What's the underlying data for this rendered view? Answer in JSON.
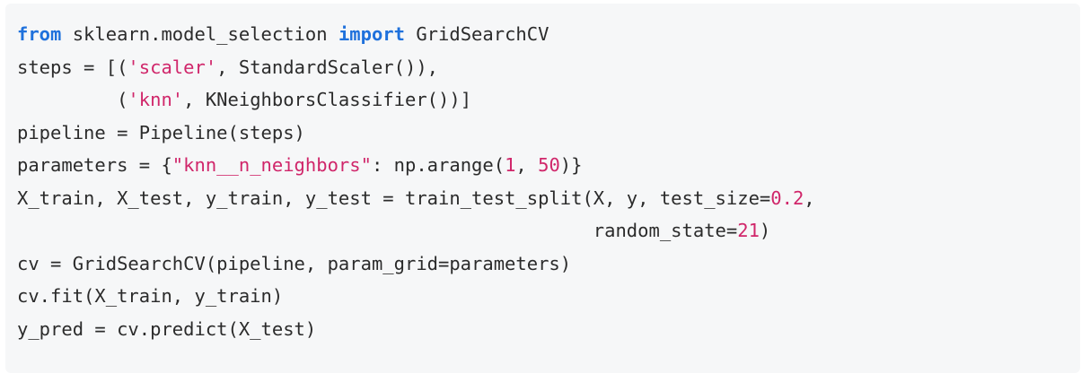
{
  "code": {
    "language": "python",
    "lines": [
      [
        {
          "t": "kw",
          "v": "from"
        },
        {
          "t": "plain",
          "v": " sklearn.model_selection "
        },
        {
          "t": "kw",
          "v": "import"
        },
        {
          "t": "plain",
          "v": " GridSearchCV"
        }
      ],
      [
        {
          "t": "plain",
          "v": "steps = [("
        },
        {
          "t": "str",
          "v": "'scaler'"
        },
        {
          "t": "plain",
          "v": ", StandardScaler()),"
        }
      ],
      [
        {
          "t": "plain",
          "v": "         ("
        },
        {
          "t": "str",
          "v": "'knn'"
        },
        {
          "t": "plain",
          "v": ", KNeighborsClassifier())]"
        }
      ],
      [
        {
          "t": "plain",
          "v": "pipeline = Pipeline(steps)"
        }
      ],
      [
        {
          "t": "plain",
          "v": "parameters = {"
        },
        {
          "t": "str",
          "v": "\"knn__n_neighbors\""
        },
        {
          "t": "plain",
          "v": ": np.arange("
        },
        {
          "t": "num",
          "v": "1"
        },
        {
          "t": "plain",
          "v": ", "
        },
        {
          "t": "num",
          "v": "50"
        },
        {
          "t": "plain",
          "v": ")}"
        }
      ],
      [
        {
          "t": "plain",
          "v": "X_train, X_test, y_train, y_test = train_test_split(X, y, test_size="
        },
        {
          "t": "num",
          "v": "0.2"
        },
        {
          "t": "plain",
          "v": ","
        }
      ],
      [
        {
          "t": "plain",
          "v": "                                                    random_state="
        },
        {
          "t": "num",
          "v": "21"
        },
        {
          "t": "plain",
          "v": ")"
        }
      ],
      [
        {
          "t": "plain",
          "v": "cv = GridSearchCV(pipeline, param_grid=parameters)"
        }
      ],
      [
        {
          "t": "plain",
          "v": "cv.fit(X_train, y_train)"
        }
      ],
      [
        {
          "t": "plain",
          "v": "y_pred = cv.predict(X_test)"
        }
      ]
    ]
  },
  "colors": {
    "keyword": "#1f71dc",
    "string": "#d0266a",
    "number": "#d0266a",
    "text": "#2b2b2b",
    "background": "#f6f7f8"
  }
}
